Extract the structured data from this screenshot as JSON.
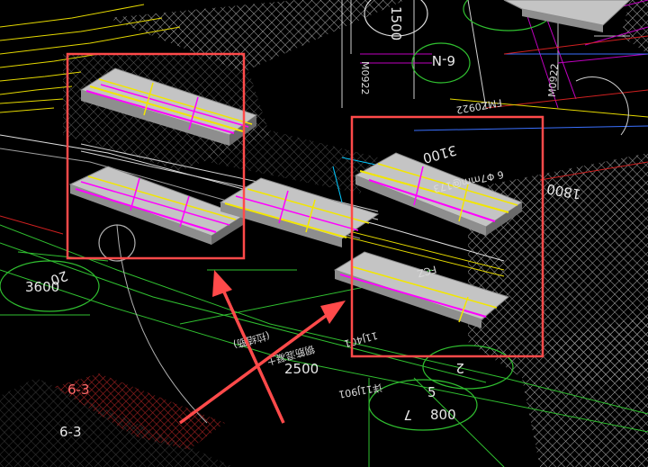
{
  "viewport": {
    "background": "#000000",
    "hatch_color": "#c8c8c8",
    "slab_color": "#bdbdbd",
    "rebar_colors": {
      "yellow": "#f2e600",
      "magenta": "#ff00ff"
    },
    "annotation_color": "#ff4a4a"
  },
  "dimensions": {
    "d3600": "3600",
    "d2500": "2500",
    "d800": "800",
    "d1800": "1800",
    "d1500": "1500",
    "d3100": "3100",
    "d20": "20"
  },
  "grid_labels": {
    "g63_red": "6-3",
    "g63_white": "6-3",
    "g6n": "6-N",
    "g5": "5",
    "g7": "7",
    "g2": "2"
  },
  "tags": {
    "m0922": "M0922",
    "fm0922": "FMZ0922",
    "m0922b": "M0922",
    "rebar_spec": "6 Φ7mm@173",
    "fcz": "FCZ",
    "note1": "详11J901",
    "note2": "11J401",
    "note3": "钢筋混凝土",
    "note4": "(拉结筋)"
  }
}
